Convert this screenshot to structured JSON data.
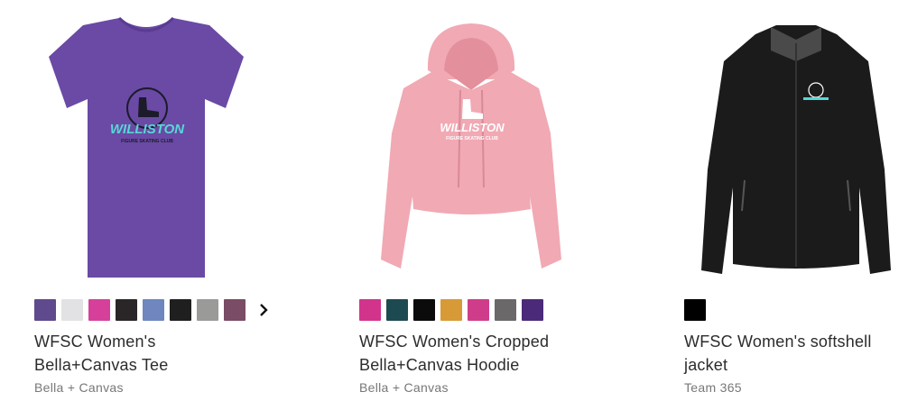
{
  "products": [
    {
      "title_line1": "WFSC Women's",
      "title_line2": "Bella+Canvas Tee",
      "brand": "Bella + Canvas",
      "logo_text": "WILLISTON",
      "logo_subtext": "FIGURE SKATING CLUB",
      "garment_color": "#6a4aa5",
      "swatches": [
        "#5e4a8c",
        "#e2e2e4",
        "#d6409a",
        "#2a2628",
        "#6f86bf",
        "#1f1f1f",
        "#9a9a98",
        "#7a4c66"
      ],
      "more_icon": "chevron-right-icon"
    },
    {
      "title_line1": "WFSC Women's Cropped",
      "title_line2": "Bella+Canvas Hoodie",
      "brand": "Bella + Canvas",
      "logo_text": "WILLISTON",
      "logo_subtext": "FIGURE SKATING CLUB",
      "garment_color": "#f1a9b4",
      "swatches": [
        "#d2348c",
        "#1d4a50",
        "#0b0b0b",
        "#d79a37",
        "#cf3d8a",
        "#6a6868",
        "#4b2a7a"
      ]
    },
    {
      "title_line1": "WFSC Women's softshell",
      "title_line2": "jacket",
      "brand": "Team 365",
      "garment_color": "#1b1b1b",
      "swatches": [
        "#000000"
      ]
    }
  ]
}
